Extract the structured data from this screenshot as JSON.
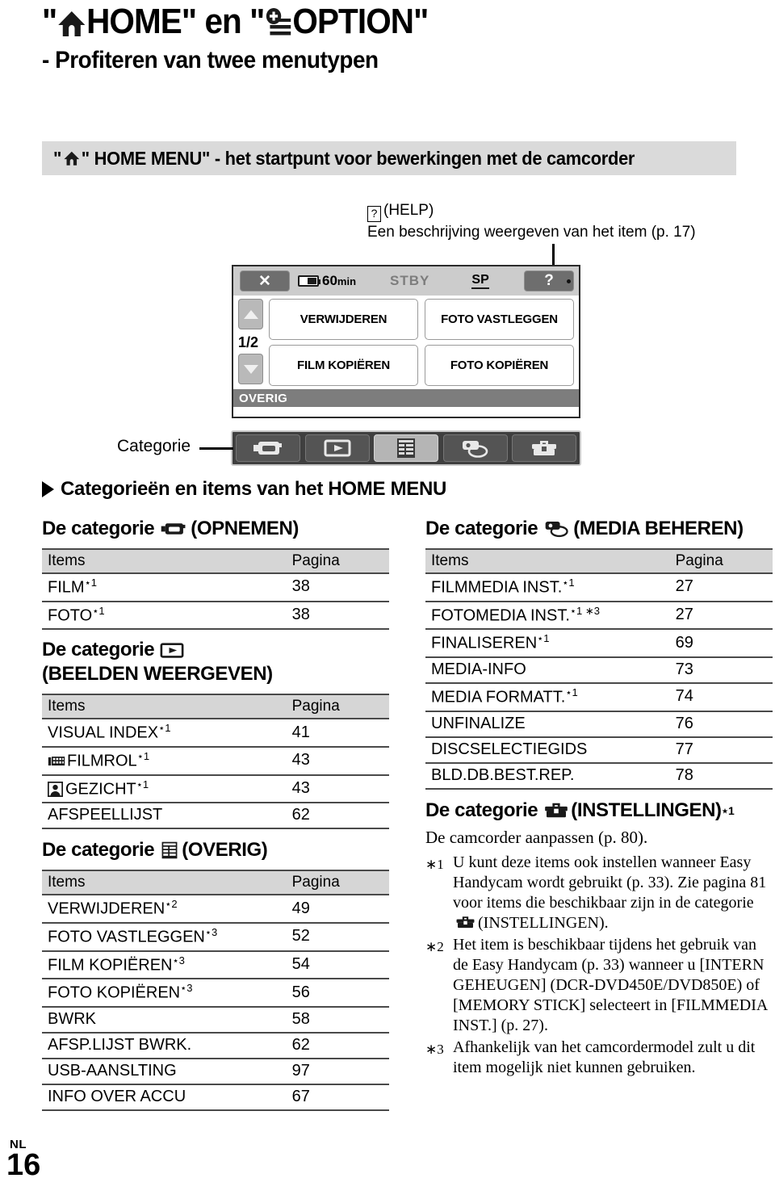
{
  "title": {
    "main_pre": "\"",
    "main_home": "HOME\" en \"",
    "main_option": "OPTION\"",
    "full": "\"⌂HOME\" en \"⊕OPTION\"",
    "subtitle": "- Profiteren van twee menutypen"
  },
  "section_bar": {
    "text": "\" HOME MENU\" - het startpunt voor bewerkingen met de camcorder"
  },
  "help_callout": {
    "line1": "(HELP)",
    "line2": "Een beschrijving weergeven van het item (p. 17)",
    "box_glyph": "?"
  },
  "lcd": {
    "close_label": "✕",
    "battery_time": "60",
    "battery_unit": "min",
    "status": "STBY",
    "quality": "SP",
    "help_label": "?",
    "page_indicator": "1/2",
    "up_arrow": "▲",
    "down_arrow": "▼",
    "buttons": [
      "VERWIJDEREN",
      "FOTO VASTLEGGEN",
      "FILM KOPIËREN",
      "FOTO KOPIËREN"
    ],
    "category_label": "OVERIG",
    "category_icons": [
      {
        "name": "camcorder-icon",
        "active": false
      },
      {
        "name": "play-icon",
        "active": false
      },
      {
        "name": "others-icon",
        "active": true
      },
      {
        "name": "manage-media-icon",
        "active": false
      },
      {
        "name": "settings-toolbox-icon",
        "active": false
      }
    ]
  },
  "categorie_callout": {
    "label": "Categorie"
  },
  "arrow_heading": {
    "text": "Categorieën en items van het HOME MENU"
  },
  "columns": {
    "left": [
      {
        "heading_pre": "De categorie",
        "heading_icon": "camcorder-icon",
        "heading_post": "(OPNEMEN)",
        "heading_sup": "",
        "table": {
          "headers": [
            "Items",
            "Pagina"
          ],
          "rows": [
            {
              "item": "FILM",
              "sup": "1",
              "page": "38"
            },
            {
              "item": "FOTO",
              "sup": "1",
              "page": "38"
            }
          ]
        }
      },
      {
        "heading_pre": "De categorie",
        "heading_icon": "play-icon",
        "heading_post": "(BEELDEN WEERGEVEN)",
        "heading_sup": "",
        "table": {
          "headers": [
            "Items",
            "Pagina"
          ],
          "rows": [
            {
              "item": "VISUAL INDEX",
              "sup": "1",
              "page": "41",
              "icon": ""
            },
            {
              "item": "FILMROL",
              "sup": "1",
              "page": "43",
              "icon": "filmroll-icon"
            },
            {
              "item": "GEZICHT",
              "sup": "1",
              "page": "43",
              "icon": "face-icon"
            },
            {
              "item": "AFSPEELLIJST",
              "sup": "",
              "page": "62",
              "icon": ""
            }
          ]
        }
      },
      {
        "heading_pre": "De categorie",
        "heading_icon": "others-icon",
        "heading_post": "(OVERIG)",
        "heading_sup": "",
        "table": {
          "headers": [
            "Items",
            "Pagina"
          ],
          "rows": [
            {
              "item": "VERWIJDEREN",
              "sup": "2",
              "page": "49"
            },
            {
              "item": "FOTO VASTLEGGEN",
              "sup": "3",
              "page": "52"
            },
            {
              "item": "FILM KOPIËREN",
              "sup": "3",
              "page": "54"
            },
            {
              "item": "FOTO KOPIËREN",
              "sup": "3",
              "page": "56"
            },
            {
              "item": "BWRK",
              "sup": "",
              "page": "58"
            },
            {
              "item": "AFSP.LIJST BWRK.",
              "sup": "",
              "page": "62"
            },
            {
              "item": "USB-AANSLTING",
              "sup": "",
              "page": "97"
            },
            {
              "item": "INFO OVER ACCU",
              "sup": "",
              "page": "67"
            }
          ]
        }
      }
    ],
    "right": [
      {
        "heading_pre": "De categorie",
        "heading_icon": "manage-media-icon",
        "heading_post": "(MEDIA BEHEREN)",
        "heading_sup": "",
        "table": {
          "headers": [
            "Items",
            "Pagina"
          ],
          "rows": [
            {
              "item": "FILMMEDIA INST.",
              "sup": "1",
              "page": "27"
            },
            {
              "item": "FOTOMEDIA INST.",
              "sup": "1 ∗3",
              "page": "27"
            },
            {
              "item": "FINALISEREN",
              "sup": "1",
              "page": "69"
            },
            {
              "item": "MEDIA-INFO",
              "sup": "",
              "page": "73"
            },
            {
              "item": "MEDIA FORMATT.",
              "sup": "1",
              "page": "74"
            },
            {
              "item": "UNFINALIZE",
              "sup": "",
              "page": "76"
            },
            {
              "item": "DISCSELECTIEGIDS",
              "sup": "",
              "page": "77"
            },
            {
              "item": "BLD.DB.BEST.REP.",
              "sup": "",
              "page": "78"
            }
          ]
        }
      }
    ],
    "settings_heading": {
      "pre": "De categorie",
      "icon": "settings-toolbox-icon",
      "post": "(INSTELLINGEN)",
      "sup": "1"
    },
    "settings_note": "De camcorder aanpassen (p. 80)."
  },
  "footnotes": [
    {
      "mark": "∗1",
      "part1": "U kunt deze items ook instellen wanneer Easy Handycam wordt gebruikt (p. 33). Zie pagina 81 voor items die beschikbaar zijn in de categorie",
      "icon": "settings-toolbox-icon",
      "part2": "(INSTELLINGEN)."
    },
    {
      "mark": "∗2",
      "part1": "Het item is beschikbaar tijdens het gebruik van de Easy Handycam (p. 33) wanneer u [INTERN GEHEUGEN] (DCR-DVD450E/DVD850E) of [MEMORY STICK] selecteert in [FILMMEDIA INST.] (p. 27).",
      "icon": "",
      "part2": ""
    },
    {
      "mark": "∗3",
      "part1": "Afhankelijk van het camcordermodel zult u dit item mogelijk niet kunnen gebruiken.",
      "icon": "",
      "part2": ""
    }
  ],
  "footer": {
    "lang": "NL",
    "page": "16"
  }
}
